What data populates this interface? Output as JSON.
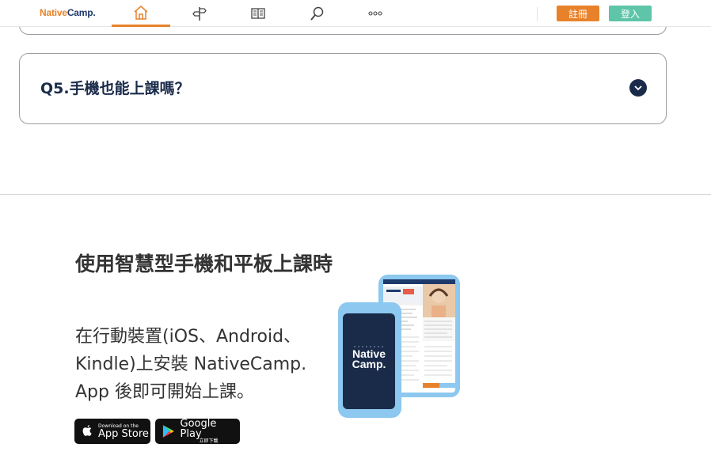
{
  "header": {
    "logo_part1": "Native",
    "logo_part2": "Camp.",
    "nav": [
      {
        "icon": "home-icon",
        "active": true
      },
      {
        "icon": "signpost-icon",
        "active": false
      },
      {
        "icon": "book-icon",
        "active": false
      },
      {
        "icon": "search-icon",
        "active": false
      },
      {
        "icon": "more-icon",
        "active": false
      }
    ],
    "register_label": "註冊",
    "login_label": "登入"
  },
  "faq": {
    "question": "Q5.手機也能上課嗎？",
    "toggle_icon": "chevron-down-icon"
  },
  "app_section": {
    "title": "使用智慧型手機和平板上課時",
    "description": "在行動裝置(iOS、Android、Kindle)上安裝 NativeCamp. App 後即可開始上課。",
    "phone_logo_line1": "Native",
    "phone_logo_line2": "Camp.",
    "app_store": {
      "small": "Download on the",
      "big": "App Store"
    },
    "google_play": {
      "big": "Google Play",
      "small": "立即下載"
    }
  },
  "colors": {
    "brand_orange": "#e8822a",
    "brand_navy": "#1e3a6b",
    "login_green": "#5ec5a8",
    "phone_blue": "#8cc8f0"
  }
}
